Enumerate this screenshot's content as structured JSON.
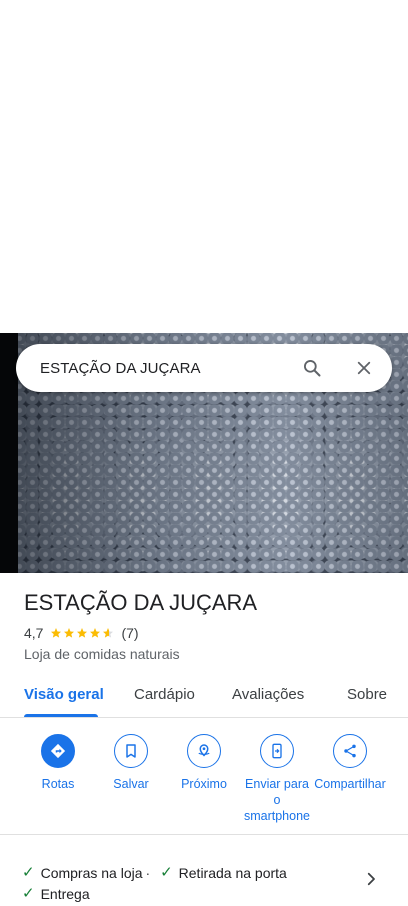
{
  "search": {
    "query": "ESTAÇÃO DA JUÇARA"
  },
  "place": {
    "name": "ESTAÇÃO DA JUÇARA",
    "rating": "4,7",
    "rating_value": 4.7,
    "review_count": "(7)",
    "category": "Loja de comidas naturais"
  },
  "tabs": [
    "Visão geral",
    "Cardápio",
    "Avaliações",
    "Sobre"
  ],
  "actions": [
    {
      "label": "Rotas",
      "icon": "directions-icon"
    },
    {
      "label": "Salvar",
      "icon": "bookmark-icon"
    },
    {
      "label": "Próximo",
      "icon": "nearby-icon"
    },
    {
      "label": "Enviar para o smartphone",
      "icon": "send-to-phone-icon"
    },
    {
      "label": "Compartilhar",
      "icon": "share-icon"
    }
  ],
  "services": [
    "Compras na loja",
    "Retirada na porta",
    "Entrega"
  ],
  "colors": {
    "accent": "#1a73e8",
    "star": "#fbbc04",
    "check": "#188038"
  }
}
